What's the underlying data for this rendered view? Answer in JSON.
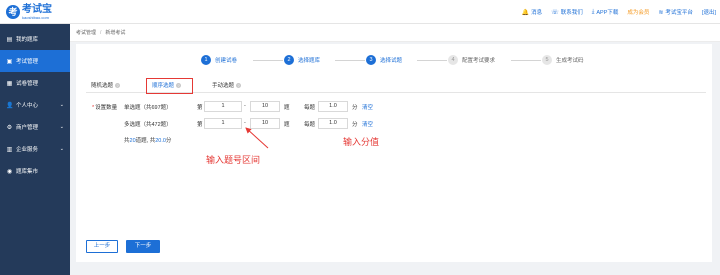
{
  "brand": {
    "name": "考试宝",
    "domain": "kaoshibao.com",
    "color": "#1d6fd6"
  },
  "topnav": [
    {
      "icon": "bell-icon",
      "glyph": "🔔",
      "label": "消息"
    },
    {
      "icon": "headset-icon",
      "glyph": "☏",
      "label": "联系我们"
    },
    {
      "icon": "download-icon",
      "glyph": "⤓",
      "label": "APP下载"
    },
    {
      "icon": "",
      "glyph": "",
      "label": "成为会员"
    },
    {
      "icon": "wifi-icon",
      "glyph": "≋",
      "label": "考试宝平台"
    },
    {
      "icon": "",
      "glyph": "",
      "label": "[退出]"
    }
  ],
  "sidebar": {
    "items": [
      {
        "label": "我的题库",
        "glyph": "▤",
        "icon": "library-icon",
        "expandable": false
      },
      {
        "label": "考试管理",
        "glyph": "▣",
        "icon": "exam-icon",
        "expandable": false,
        "active": true
      },
      {
        "label": "试卷管理",
        "glyph": "▦",
        "icon": "paper-icon",
        "expandable": false
      },
      {
        "label": "个人中心",
        "glyph": "👤",
        "icon": "user-icon",
        "expandable": true
      },
      {
        "label": "商户管理",
        "glyph": "⚙",
        "icon": "merchant-icon",
        "expandable": true
      },
      {
        "label": "企业服务",
        "glyph": "▥",
        "icon": "enterprise-icon",
        "expandable": true
      },
      {
        "label": "题库集市",
        "glyph": "◉",
        "icon": "market-icon",
        "expandable": false
      }
    ]
  },
  "breadcrumb": {
    "parent": "考试管理",
    "separator": "/",
    "current": "新增考试"
  },
  "steps": [
    {
      "num": "1",
      "label": "创建试卷",
      "state": "done"
    },
    {
      "num": "2",
      "label": "选择题库",
      "state": "done"
    },
    {
      "num": "3",
      "label": "选择试题",
      "state": "done"
    },
    {
      "num": "4",
      "label": "配置考试要求",
      "state": "todo"
    },
    {
      "num": "5",
      "label": "生成考试码",
      "state": "todo"
    }
  ],
  "tabs": [
    {
      "label": "随机选题",
      "active": false
    },
    {
      "label": "顺序选题",
      "active": true
    },
    {
      "label": "手动选题",
      "active": false
    }
  ],
  "form": {
    "quantity_label": "设置数量",
    "rows": [
      {
        "type_label": "单选题（共697题）",
        "from_label": "第",
        "from_value": "1",
        "dash": "-",
        "to_value": "10",
        "to_unit": "题",
        "score_label": "每题",
        "score_value": "1.0",
        "score_unit": "分",
        "clear": "清空"
      },
      {
        "type_label": "多选题（共472题）",
        "from_label": "第",
        "from_value": "1",
        "dash": "-",
        "to_value": "10",
        "to_unit": "题",
        "score_label": "每题",
        "score_value": "1.0",
        "score_unit": "分",
        "clear": "清空"
      }
    ],
    "summary": {
      "prefix": "共",
      "count": "20",
      "mid": "道题, 共",
      "score": "20.0",
      "suffix": "分"
    }
  },
  "annotations": {
    "range": "输入题号区间",
    "score": "输入分值",
    "color": "#e53935"
  },
  "buttons": {
    "prev": "上一步",
    "next": "下一步"
  }
}
